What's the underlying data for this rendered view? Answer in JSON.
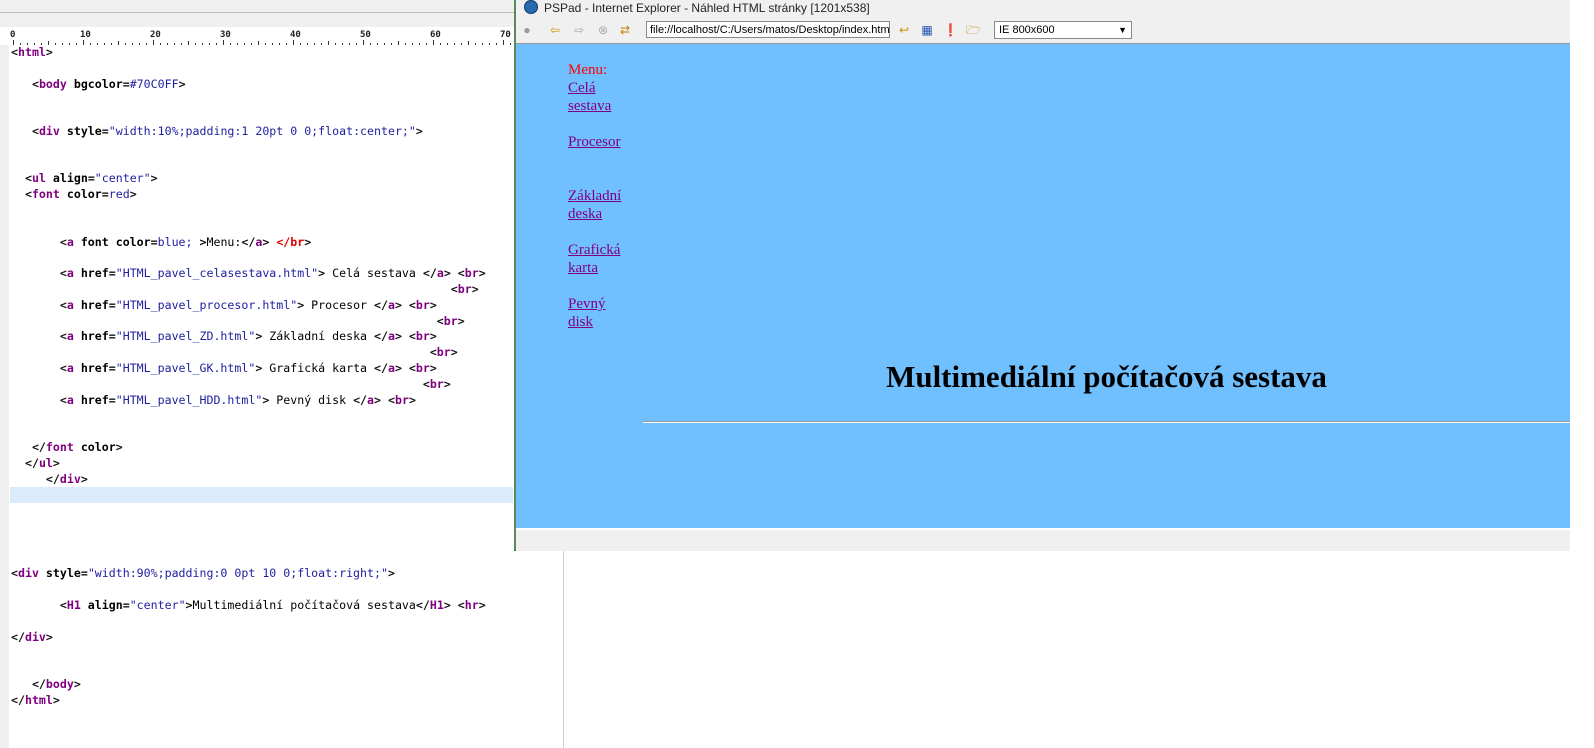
{
  "editor": {
    "ruler_labels": [
      "0",
      "10",
      "20",
      "30",
      "40",
      "50",
      "60",
      "70"
    ],
    "lines": [
      {
        "n": 0,
        "tokens": [
          [
            "b",
            "<"
          ],
          [
            "t",
            "html"
          ],
          [
            "b",
            ">"
          ]
        ]
      },
      {
        "n": 2,
        "tokens": [
          [
            "x",
            "   "
          ],
          [
            "b",
            "<"
          ],
          [
            "t",
            "body"
          ],
          [
            "a",
            " bgcolor"
          ],
          [
            "b",
            "="
          ],
          [
            "s",
            "#70C0FF"
          ],
          [
            "b",
            ">"
          ]
        ]
      },
      {
        "n": 5,
        "tokens": [
          [
            "x",
            "   "
          ],
          [
            "b",
            "<"
          ],
          [
            "t",
            "div"
          ],
          [
            "a",
            " style"
          ],
          [
            "b",
            "="
          ],
          [
            "s",
            "\"width:10%;padding:1 20pt 0 0;float:center;\""
          ],
          [
            "b",
            ">"
          ]
        ]
      },
      {
        "n": 8,
        "tokens": [
          [
            "x",
            "  "
          ],
          [
            "b",
            "<"
          ],
          [
            "t",
            "ul"
          ],
          [
            "a",
            " align"
          ],
          [
            "b",
            "="
          ],
          [
            "s",
            "\"center\""
          ],
          [
            "b",
            ">"
          ]
        ]
      },
      {
        "n": 9,
        "tokens": [
          [
            "x",
            "  "
          ],
          [
            "b",
            "<"
          ],
          [
            "t",
            "font"
          ],
          [
            "a",
            " color"
          ],
          [
            "b",
            "="
          ],
          [
            "s",
            "red"
          ],
          [
            "b",
            ">"
          ]
        ]
      },
      {
        "n": 12,
        "tokens": [
          [
            "x",
            "       "
          ],
          [
            "b",
            "<"
          ],
          [
            "t",
            "a"
          ],
          [
            "a",
            " font color"
          ],
          [
            "b",
            "="
          ],
          [
            "s",
            "blue; "
          ],
          [
            "b",
            ">"
          ],
          [
            "x",
            "Menu:"
          ],
          [
            "b",
            "</"
          ],
          [
            "t",
            "a"
          ],
          [
            "b",
            "> "
          ],
          [
            "r",
            "</br"
          ],
          [
            "b",
            ">"
          ]
        ]
      },
      {
        "n": 14,
        "tokens": [
          [
            "x",
            "       "
          ],
          [
            "b",
            "<"
          ],
          [
            "t",
            "a"
          ],
          [
            "a",
            " href"
          ],
          [
            "b",
            "="
          ],
          [
            "s",
            "\"HTML_pavel_celasestava.html\""
          ],
          [
            "b",
            ">"
          ],
          [
            "x",
            " Celá sestava "
          ],
          [
            "b",
            "</"
          ],
          [
            "t",
            "a"
          ],
          [
            "b",
            "> <"
          ],
          [
            "t",
            "br"
          ],
          [
            "b",
            ">"
          ]
        ]
      },
      {
        "n": 15,
        "tokens": [
          [
            "x",
            "                                                               "
          ],
          [
            "b",
            "<"
          ],
          [
            "t",
            "br"
          ],
          [
            "b",
            ">"
          ]
        ]
      },
      {
        "n": 16,
        "tokens": [
          [
            "x",
            "       "
          ],
          [
            "b",
            "<"
          ],
          [
            "t",
            "a"
          ],
          [
            "a",
            " href"
          ],
          [
            "b",
            "="
          ],
          [
            "s",
            "\"HTML_pavel_procesor.html\""
          ],
          [
            "b",
            ">"
          ],
          [
            "x",
            " Procesor "
          ],
          [
            "b",
            "</"
          ],
          [
            "t",
            "a"
          ],
          [
            "b",
            "> <"
          ],
          [
            "t",
            "br"
          ],
          [
            "b",
            ">"
          ]
        ]
      },
      {
        "n": 17,
        "tokens": [
          [
            "x",
            "                                                             "
          ],
          [
            "b",
            "<"
          ],
          [
            "t",
            "br"
          ],
          [
            "b",
            ">"
          ]
        ]
      },
      {
        "n": 18,
        "tokens": [
          [
            "x",
            "       "
          ],
          [
            "b",
            "<"
          ],
          [
            "t",
            "a"
          ],
          [
            "a",
            " href"
          ],
          [
            "b",
            "="
          ],
          [
            "s",
            "\"HTML_pavel_ZD.html\""
          ],
          [
            "b",
            ">"
          ],
          [
            "x",
            " Základní deska "
          ],
          [
            "b",
            "</"
          ],
          [
            "t",
            "a"
          ],
          [
            "b",
            "> <"
          ],
          [
            "t",
            "br"
          ],
          [
            "b",
            ">"
          ]
        ]
      },
      {
        "n": 19,
        "tokens": [
          [
            "x",
            "                                                            "
          ],
          [
            "b",
            "<"
          ],
          [
            "t",
            "br"
          ],
          [
            "b",
            ">"
          ]
        ]
      },
      {
        "n": 20,
        "tokens": [
          [
            "x",
            "       "
          ],
          [
            "b",
            "<"
          ],
          [
            "t",
            "a"
          ],
          [
            "a",
            " href"
          ],
          [
            "b",
            "="
          ],
          [
            "s",
            "\"HTML_pavel_GK.html\""
          ],
          [
            "b",
            ">"
          ],
          [
            "x",
            " Grafická karta "
          ],
          [
            "b",
            "</"
          ],
          [
            "t",
            "a"
          ],
          [
            "b",
            "> <"
          ],
          [
            "t",
            "br"
          ],
          [
            "b",
            ">"
          ]
        ]
      },
      {
        "n": 21,
        "tokens": [
          [
            "x",
            "                                                           "
          ],
          [
            "b",
            "<"
          ],
          [
            "t",
            "br"
          ],
          [
            "b",
            ">"
          ]
        ]
      },
      {
        "n": 22,
        "tokens": [
          [
            "x",
            "       "
          ],
          [
            "b",
            "<"
          ],
          [
            "t",
            "a"
          ],
          [
            "a",
            " href"
          ],
          [
            "b",
            "="
          ],
          [
            "s",
            "\"HTML_pavel_HDD.html\""
          ],
          [
            "b",
            ">"
          ],
          [
            "x",
            " Pevný disk "
          ],
          [
            "b",
            "</"
          ],
          [
            "t",
            "a"
          ],
          [
            "b",
            "> <"
          ],
          [
            "t",
            "br"
          ],
          [
            "b",
            ">"
          ]
        ]
      },
      {
        "n": 25,
        "tokens": [
          [
            "x",
            "   "
          ],
          [
            "b",
            "</"
          ],
          [
            "t",
            "font"
          ],
          [
            "a",
            " color"
          ],
          [
            "b",
            ">"
          ]
        ]
      },
      {
        "n": 26,
        "tokens": [
          [
            "x",
            "  "
          ],
          [
            "b",
            "</"
          ],
          [
            "t",
            "ul"
          ],
          [
            "b",
            ">"
          ]
        ]
      },
      {
        "n": 27,
        "tokens": [
          [
            "x",
            "     "
          ],
          [
            "b",
            "</"
          ],
          [
            "t",
            "div"
          ],
          [
            "b",
            ">"
          ]
        ]
      },
      {
        "n": 33,
        "tokens": [
          [
            "b",
            "<"
          ],
          [
            "t",
            "div"
          ],
          [
            "a",
            " style"
          ],
          [
            "b",
            "="
          ],
          [
            "s",
            "\"width:90%;padding:0 0pt 10 0;float:right;\""
          ],
          [
            "b",
            ">"
          ]
        ]
      },
      {
        "n": 35,
        "tokens": [
          [
            "x",
            "       "
          ],
          [
            "b",
            "<"
          ],
          [
            "t",
            "H1"
          ],
          [
            "a",
            " align"
          ],
          [
            "b",
            "="
          ],
          [
            "s",
            "\"center\""
          ],
          [
            "b",
            ">"
          ],
          [
            "x",
            "Multimediální počítačová sestava"
          ],
          [
            "b",
            "</"
          ],
          [
            "t",
            "H1"
          ],
          [
            "b",
            "> <"
          ],
          [
            "t",
            "hr"
          ],
          [
            "b",
            ">"
          ]
        ]
      },
      {
        "n": 37,
        "tokens": [
          [
            "b",
            "</"
          ],
          [
            "t",
            "div"
          ],
          [
            "b",
            ">"
          ]
        ]
      },
      {
        "n": 40,
        "tokens": [
          [
            "x",
            "   "
          ],
          [
            "b",
            "</"
          ],
          [
            "t",
            "body"
          ],
          [
            "b",
            ">"
          ]
        ]
      },
      {
        "n": 41,
        "tokens": [
          [
            "b",
            "</"
          ],
          [
            "t",
            "html"
          ],
          [
            "b",
            ">"
          ]
        ]
      }
    ]
  },
  "preview": {
    "title": "PSPad - Internet Explorer - Náhled HTML stránky   [1201x538]",
    "url": "file://localhost/C:/Users/matos/Desktop/index.html",
    "size_select": "IE 800x600",
    "page": {
      "bgcolor": "#70C0FF",
      "menu_label": "Menu:",
      "links": [
        "Celá sestava",
        "Procesor",
        "Základní deska",
        "Grafická karta",
        "Pevný disk"
      ],
      "heading": "Multimediální počítačová sestava"
    }
  }
}
